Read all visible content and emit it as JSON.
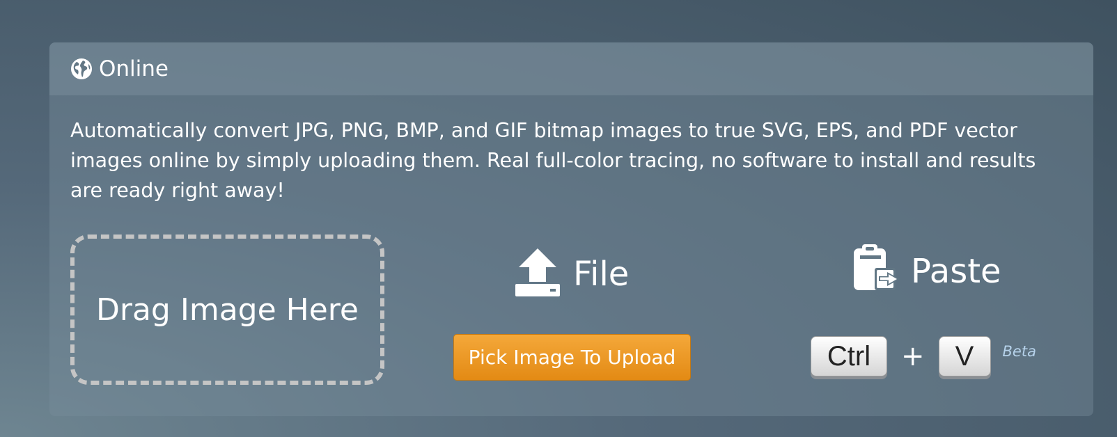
{
  "panel": {
    "header_title": "Online",
    "header_icon": "globe-icon",
    "description": "Automatically convert JPG, PNG, BMP, and GIF bitmap images to true SVG, EPS, and PDF vector images online by simply uploading them. Real full-color tracing, no software to install and results are ready right away!"
  },
  "drop_zone": {
    "label": "Drag Image Here"
  },
  "file_section": {
    "icon": "upload-icon",
    "label": "File",
    "button_label": "Pick Image To Upload",
    "button_color": "#ee9a27"
  },
  "paste_section": {
    "icon": "clipboard-paste-icon",
    "label": "Paste",
    "keys": [
      "Ctrl",
      "V"
    ],
    "plus": "+",
    "badge": "Beta"
  }
}
